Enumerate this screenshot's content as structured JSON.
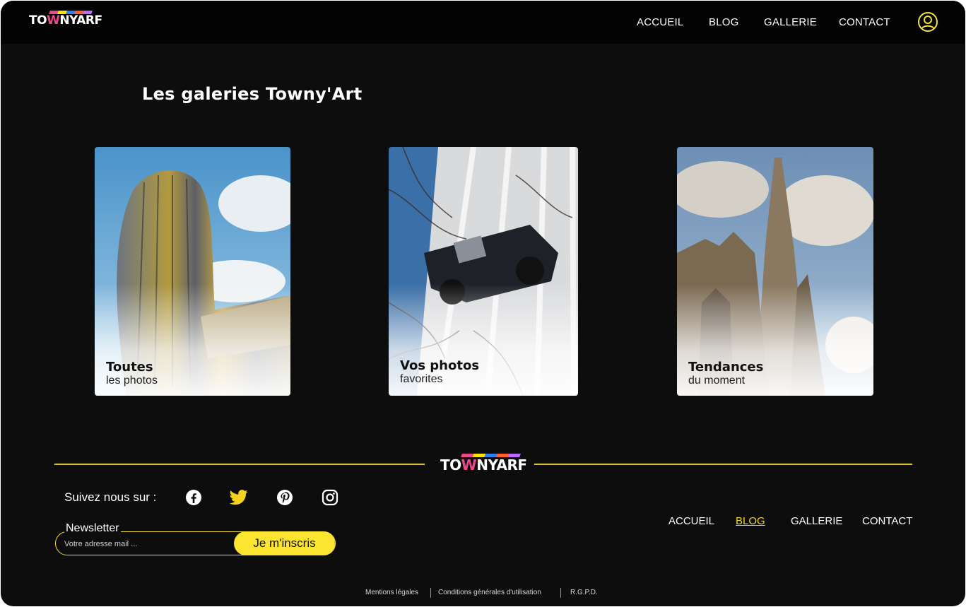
{
  "header": {
    "logo_text_a": "TO",
    "logo_text_w": "W",
    "logo_text_b": "NYARF",
    "nav": [
      "ACCUEIL",
      "BLOG",
      "GALLERIE",
      "CONTACT"
    ]
  },
  "main": {
    "title": "Les galeries Towny'Art",
    "cards": [
      {
        "title": "Toutes",
        "subtitle": "les photos"
      },
      {
        "title": "Vos photos",
        "subtitle": "favorites"
      },
      {
        "title": "Tendances",
        "subtitle": "du moment"
      }
    ]
  },
  "footer": {
    "follow_label": "Suivez nous sur :",
    "socials": [
      "facebook-icon",
      "twitter-icon",
      "pinterest-icon",
      "instagram-icon"
    ],
    "newsletter_label": "Newsletter",
    "email_placeholder": "Votre adresse mail ...",
    "subscribe_label": "Je m'inscris",
    "nav": [
      "ACCUEIL",
      "BLOG",
      "GALLERIE",
      "CONTACT"
    ],
    "active_nav": "BLOG",
    "legal": [
      "Mentions légales",
      "Conditions générales d'utilisation",
      "R.G.P.D."
    ]
  },
  "colors": {
    "background": "#0d0d0d",
    "accent_yellow": "#fce531",
    "brand_pink": "#e84b8a"
  }
}
